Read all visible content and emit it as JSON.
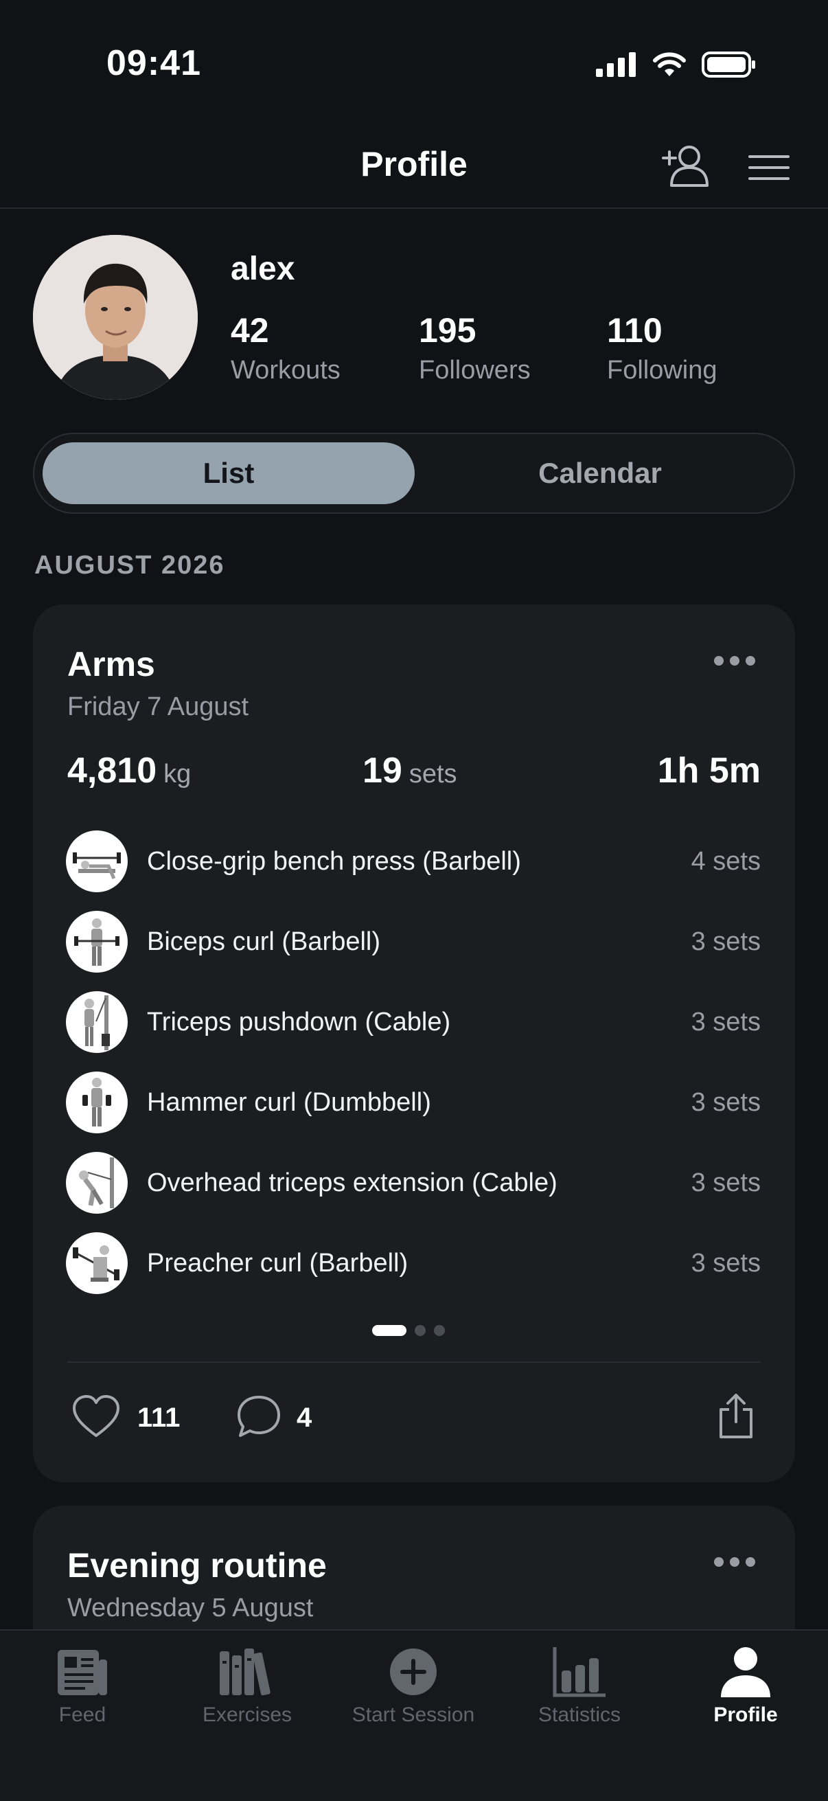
{
  "status_bar": {
    "time": "09:41"
  },
  "header": {
    "title": "Profile"
  },
  "profile": {
    "username": "alex",
    "stats": [
      {
        "value": "42",
        "label": "Workouts"
      },
      {
        "value": "195",
        "label": "Followers"
      },
      {
        "value": "110",
        "label": "Following"
      }
    ]
  },
  "view_toggle": {
    "selected": "List",
    "options": [
      "List",
      "Calendar"
    ]
  },
  "month_header": "AUGUST 2026",
  "workouts": [
    {
      "title": "Arms",
      "date": "Friday 7 August",
      "volume_value": "4,810",
      "volume_unit": "kg",
      "sets_value": "19",
      "sets_unit": "sets",
      "duration": "1h 5m",
      "exercises": [
        {
          "name": "Close-grip bench press (Barbell)",
          "sets": "4 sets"
        },
        {
          "name": "Biceps curl (Barbell)",
          "sets": "3 sets"
        },
        {
          "name": "Triceps pushdown (Cable)",
          "sets": "3 sets"
        },
        {
          "name": "Hammer curl (Dumbbell)",
          "sets": "3 sets"
        },
        {
          "name": "Overhead triceps extension (Cable)",
          "sets": "3 sets"
        },
        {
          "name": "Preacher curl (Barbell)",
          "sets": "3 sets"
        }
      ],
      "likes": "111",
      "comments": "4"
    },
    {
      "title": "Evening routine",
      "date": "Wednesday 5 August"
    }
  ],
  "tab_bar": {
    "items": [
      {
        "label": "Feed",
        "icon": "feed-icon"
      },
      {
        "label": "Exercises",
        "icon": "exercises-icon"
      },
      {
        "label": "Start Session",
        "icon": "plus-circle-icon"
      },
      {
        "label": "Statistics",
        "icon": "bar-chart-icon"
      },
      {
        "label": "Profile",
        "icon": "person-icon"
      }
    ],
    "active": "Profile"
  },
  "colors": {
    "background": "#111215",
    "card": "#1b1d21",
    "segment_active": "#95a3af",
    "muted_text": "#9a9da4"
  }
}
